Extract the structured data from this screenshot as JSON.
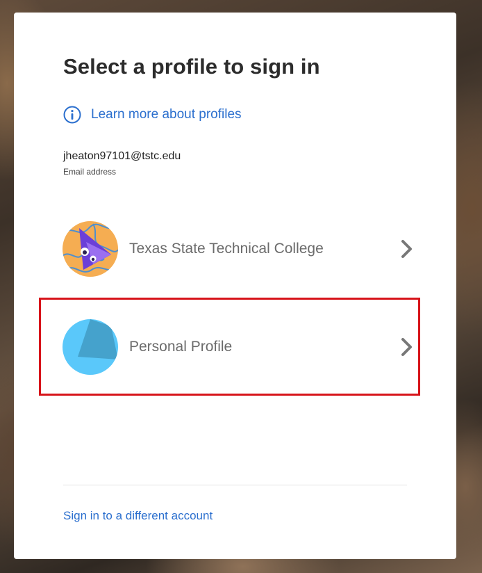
{
  "page": {
    "title": "Select a profile to sign in",
    "learn_more": "Learn more about profiles",
    "email": "jheaton97101@tstc.edu",
    "email_label": "Email address",
    "different_account": "Sign in to a different account"
  },
  "profiles": [
    {
      "name": "Texas State Technical College",
      "avatar": "organization-mascot-avatar"
    },
    {
      "name": "Personal Profile",
      "avatar": "personal-default-avatar",
      "highlighted": true
    }
  ],
  "colors": {
    "link": "#2b6fce",
    "highlight_border": "#d7141a",
    "org_avatar_bg": "#f5ad52",
    "personal_avatar_bg": "#5ac8fa"
  },
  "icons": [
    "info-icon",
    "chevron-right-icon"
  ]
}
